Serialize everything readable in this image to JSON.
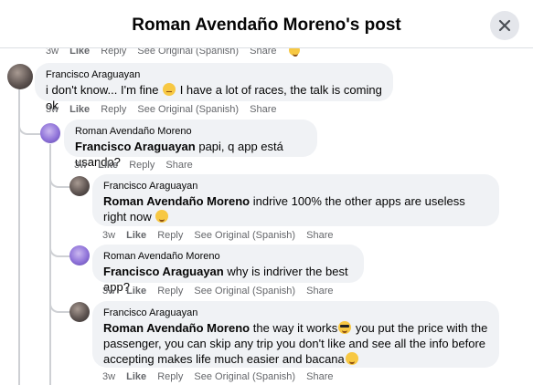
{
  "header": {
    "title": "Roman Avendaño Moreno's post",
    "close_icon": "close-icon"
  },
  "top_actions": {
    "time": "3w",
    "like": "Like",
    "reply": "Reply",
    "see_original": "See Original (Spanish)",
    "share": "Share",
    "reaction_icon": "laugh-emoji-icon"
  },
  "comments": [
    {
      "author": "Francisco Araguayan",
      "text": "i don't know... I'm fine",
      "emoji": "thinking-emoji-icon",
      "text_after": " I have a lot of races, the talk is coming ok",
      "actions": {
        "time": "3w",
        "like": "Like",
        "reply": "Reply",
        "see_original": "See Original (Spanish)",
        "share": "Share"
      }
    },
    {
      "author": "Roman Avendaño Moreno",
      "mention": "Francisco Araguayan",
      "text": " papi, q app está usando?",
      "actions": {
        "time": "3w",
        "like": "Like",
        "reply": "Reply",
        "share": "Share"
      }
    },
    {
      "author": "Francisco Araguayan",
      "mention": "Roman Avendaño Moreno",
      "text": " indrive 100% the other apps are useless right now",
      "emoji": "grinning-emoji-icon",
      "actions": {
        "time": "3w",
        "like": "Like",
        "reply": "Reply",
        "see_original": "See Original (Spanish)",
        "share": "Share"
      }
    },
    {
      "author": "Roman Avendaño Moreno",
      "mention": "Francisco Araguayan",
      "text": " why is indriver the best app?",
      "actions": {
        "time": "3w",
        "like": "Like",
        "reply": "Reply",
        "see_original": "See Original (Spanish)",
        "share": "Share"
      }
    },
    {
      "author": "Francisco Araguayan",
      "mention": "Roman Avendaño Moreno",
      "text": " the way it works",
      "emoji": "sunglasses-emoji-icon",
      "text_after": " you put the price with the passenger, you can skip any trip you don't like and see all the info before accepting makes life much easier and bacana",
      "emoji2": "grinning-emoji-icon",
      "actions": {
        "time": "3w",
        "like": "Like",
        "reply": "Reply",
        "see_original": "See Original (Spanish)",
        "share": "Share"
      }
    }
  ]
}
